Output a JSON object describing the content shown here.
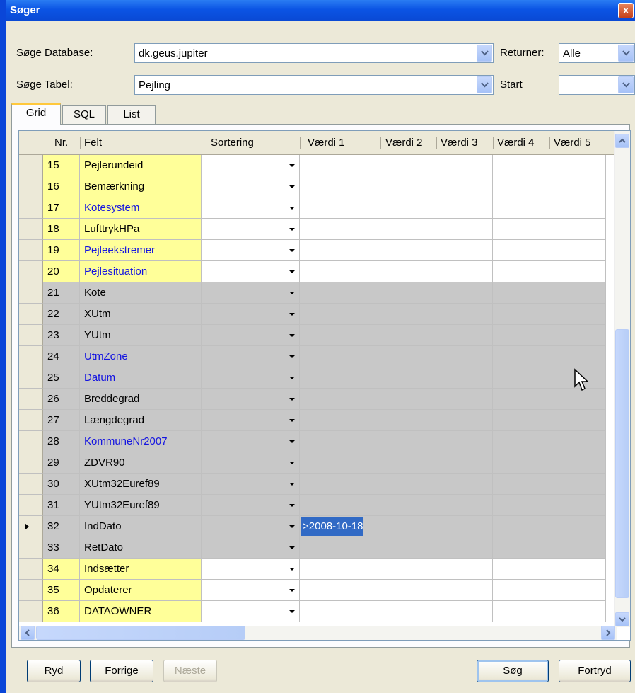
{
  "window": {
    "title": "Søger",
    "close_label": "x"
  },
  "form": {
    "db_label": "Søge Database:",
    "db_value": "dk.geus.jupiter",
    "table_label": "Søge Tabel:",
    "table_value": "Pejling",
    "return_label": "Returner:",
    "return_value": "Alle",
    "start_label": "Start",
    "start_value": ""
  },
  "tabs": [
    {
      "label": "Grid",
      "active": true
    },
    {
      "label": "SQL",
      "active": false
    },
    {
      "label": "List",
      "active": false
    }
  ],
  "grid": {
    "columns": [
      "Nr.",
      "Felt",
      "Sortering",
      "Værdi 1",
      "Værdi 2",
      "Værdi 3",
      "Værdi 4",
      "Værdi 5"
    ],
    "rows": [
      {
        "nr": "15",
        "felt": "Pejlerundeid",
        "style": "yellow",
        "blue": false,
        "v1": ""
      },
      {
        "nr": "16",
        "felt": "Bemærkning",
        "style": "yellow",
        "blue": false,
        "v1": ""
      },
      {
        "nr": "17",
        "felt": "Kotesystem",
        "style": "yellow",
        "blue": true,
        "v1": ""
      },
      {
        "nr": "18",
        "felt": "LufttrykHPa",
        "style": "yellow",
        "blue": false,
        "v1": ""
      },
      {
        "nr": "19",
        "felt": "Pejleekstremer",
        "style": "yellow",
        "blue": true,
        "v1": ""
      },
      {
        "nr": "20",
        "felt": "Pejlesituation",
        "style": "yellow",
        "blue": true,
        "v1": ""
      },
      {
        "nr": "21",
        "felt": "Kote",
        "style": "gray",
        "blue": false,
        "v1": ""
      },
      {
        "nr": "22",
        "felt": "XUtm",
        "style": "gray",
        "blue": false,
        "v1": ""
      },
      {
        "nr": "23",
        "felt": "YUtm",
        "style": "gray",
        "blue": false,
        "v1": ""
      },
      {
        "nr": "24",
        "felt": "UtmZone",
        "style": "gray",
        "blue": true,
        "v1": ""
      },
      {
        "nr": "25",
        "felt": "Datum",
        "style": "gray",
        "blue": true,
        "v1": ""
      },
      {
        "nr": "26",
        "felt": "Breddegrad",
        "style": "gray",
        "blue": false,
        "v1": ""
      },
      {
        "nr": "27",
        "felt": "Længdegrad",
        "style": "gray",
        "blue": false,
        "v1": ""
      },
      {
        "nr": "28",
        "felt": "KommuneNr2007",
        "style": "gray",
        "blue": true,
        "v1": ""
      },
      {
        "nr": "29",
        "felt": "ZDVR90",
        "style": "gray",
        "blue": false,
        "v1": ""
      },
      {
        "nr": "30",
        "felt": "XUtm32Euref89",
        "style": "gray",
        "blue": false,
        "v1": ""
      },
      {
        "nr": "31",
        "felt": "YUtm32Euref89",
        "style": "gray",
        "blue": false,
        "v1": ""
      },
      {
        "nr": "32",
        "felt": "IndDato",
        "style": "gray",
        "blue": false,
        "v1": ">2008-10-18",
        "current": true
      },
      {
        "nr": "33",
        "felt": "RetDato",
        "style": "gray",
        "blue": false,
        "v1": ""
      },
      {
        "nr": "34",
        "felt": "Indsætter",
        "style": "yellow",
        "blue": false,
        "v1": ""
      },
      {
        "nr": "35",
        "felt": "Opdaterer",
        "style": "yellow",
        "blue": false,
        "v1": ""
      },
      {
        "nr": "36",
        "felt": "DATAOWNER",
        "style": "yellow",
        "blue": false,
        "v1": ""
      }
    ]
  },
  "buttons": {
    "clear": "Ryd",
    "prev": "Forrige",
    "next": "Næste",
    "search": "Søg",
    "cancel": "Fortryd"
  },
  "colors": {
    "yellow": "#ffff99",
    "gray": "#c8c8c8",
    "selection": "#316ac5",
    "titlebar": "#0a54e4"
  }
}
